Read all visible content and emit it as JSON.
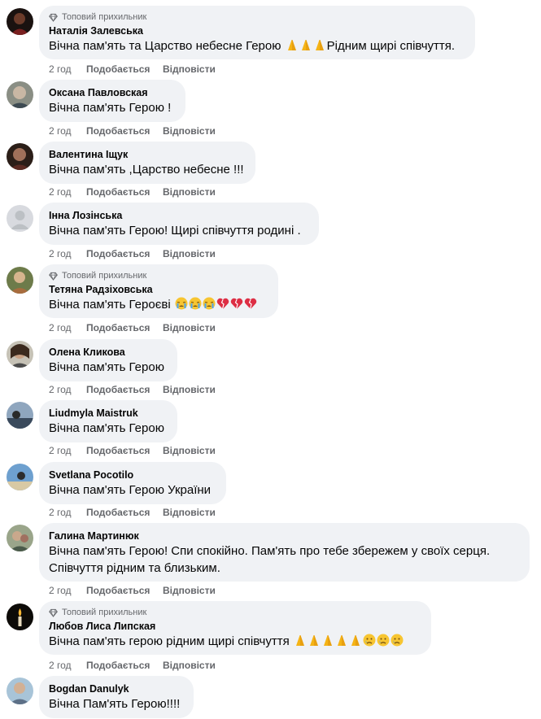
{
  "labels": {
    "top_fan": "Топовий прихильник",
    "like": "Подобається",
    "reply": "Відповісти"
  },
  "comments": [
    {
      "author": "Наталія Залевська",
      "time": "2 год",
      "top_fan": true,
      "text_before": "Вічна пам'ять та Царство небесне Герою ",
      "emojis": [
        "folded-hands",
        "folded-hands",
        "folded-hands"
      ],
      "text_after": "Рідним щирі співчуття."
    },
    {
      "author": "Оксана Павловская",
      "time": "2 год",
      "top_fan": false,
      "text_before": "Вічна пам'ять Герою !"
    },
    {
      "author": "Валентина Іщук",
      "time": "2 год",
      "top_fan": false,
      "text_before": "Вічна пам'ять ,Царство небесне !!!"
    },
    {
      "author": "Інна Лозінська",
      "time": "2 год",
      "top_fan": false,
      "text_before": "Вічна пам'ять Герою! Щирі співчуття родині ."
    },
    {
      "author": "Тетяна Радзіховська",
      "time": "2 год",
      "top_fan": true,
      "text_before": "Вічна пам'ять Героєві ",
      "emojis": [
        "crying-face",
        "crying-face",
        "crying-face",
        "broken-heart",
        "broken-heart",
        "broken-heart"
      ]
    },
    {
      "author": "Олена Кликова",
      "time": "2 год",
      "top_fan": false,
      "text_before": "Вічна пам'ять Герою"
    },
    {
      "author": "Liudmyla Maistruk",
      "time": "2 год",
      "top_fan": false,
      "text_before": "Вічна пам'ять Герою"
    },
    {
      "author": "Svetlana Pocotilo",
      "time": "2 год",
      "top_fan": false,
      "text_before": "Вічна пам'ять Герою України"
    },
    {
      "author": "Галина Мартинюк",
      "time": "2 год",
      "top_fan": false,
      "text_before": "Вічна пам'ять Герою! Спи спокійно. Пам'ять про тебе збережем у своїх серця.",
      "text_line2": "Співчуття рідним та близьким."
    },
    {
      "author": "Любов Лиса Липская",
      "time": "2 год",
      "top_fan": true,
      "text_before": "Вічна пам'ять герою рідним щирі співчуття ",
      "emojis": [
        "folded-hands",
        "folded-hands",
        "folded-hands",
        "folded-hands",
        "folded-hands",
        "sad-face",
        "sad-face",
        "sad-face"
      ]
    },
    {
      "author": "Bogdan Danulyk",
      "time": "",
      "top_fan": false,
      "text_before": "Вічна Пам'ять Герою!!!!"
    }
  ]
}
